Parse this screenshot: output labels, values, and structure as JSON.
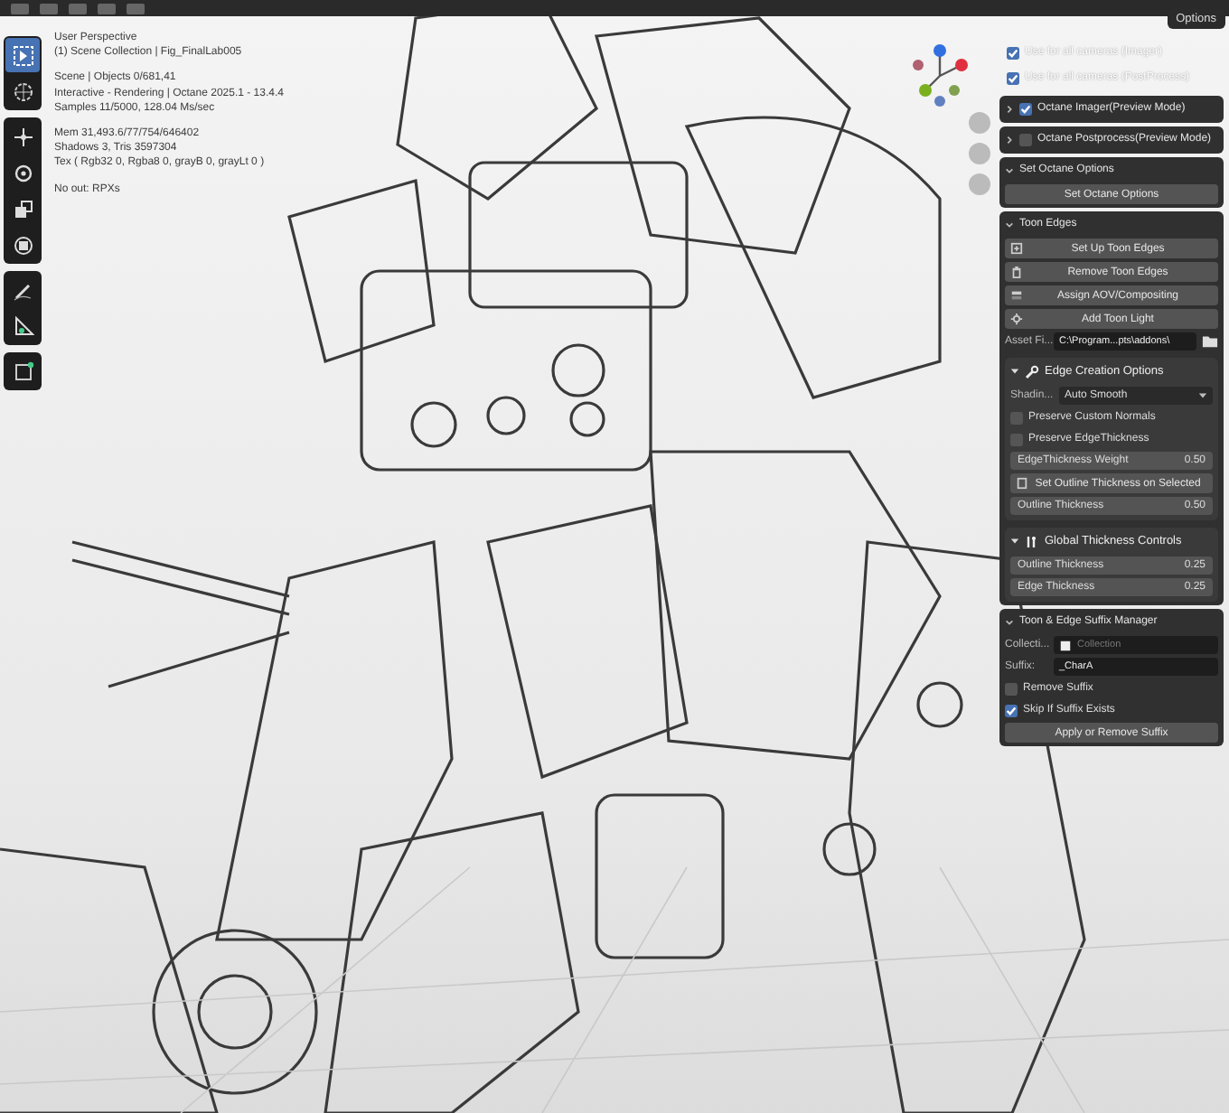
{
  "viewport_info": [
    [
      "User Perspective",
      "(1) Scene Collection | Fig_FinalLab005"
    ],
    [
      "Scene | Objects 0/681,41",
      "Interactive - Rendering | Octane 2025.1 - 13.4.4",
      "Samples 11/5000, 128.04 Ms/sec"
    ],
    [
      "Mem 31,493.6/77/754/646402",
      "Shadows 3, Tris 3597304",
      "Tex ( Rgb32 0, Rgba8 0, grayB 0, grayLt 0 )"
    ],
    [
      "No out: RPXs"
    ]
  ],
  "tools": [
    {
      "kind": "select",
      "selected": true
    },
    {
      "kind": "cursor",
      "selected": false
    },
    {
      "kind": "move",
      "selected": false
    },
    {
      "kind": "rotate",
      "selected": false
    },
    {
      "kind": "scale",
      "selected": false
    },
    {
      "kind": "transform",
      "selected": false
    },
    {
      "kind": "annotate",
      "selected": false
    },
    {
      "kind": "measure",
      "selected": false
    },
    {
      "kind": "add",
      "selected": false
    }
  ],
  "options_button": "Options",
  "camera_toggles": [
    {
      "label": "Use for all cameras (Imager)",
      "checked": true
    },
    {
      "label": "Use for all cameras (PostProcess)",
      "checked": true
    }
  ],
  "panels": [
    {
      "title": "Octane Imager(Preview Mode)",
      "checked": true,
      "expanded": false
    },
    {
      "title": "Octane Postprocess(Preview Mode)",
      "checked": false,
      "expanded": false
    },
    {
      "title": "Set Octane Options",
      "expanded": true,
      "items": [
        {
          "kind": "button",
          "label": "Set Octane Options"
        }
      ]
    },
    {
      "title": "Toon Edges",
      "expanded": true,
      "items": [
        {
          "kind": "button",
          "label": "Set Up Toon Edges"
        },
        {
          "kind": "button",
          "label": "Remove Toon Edges"
        },
        {
          "kind": "button",
          "label": "Assign AOV/Compositing"
        },
        {
          "kind": "button",
          "label": "Add Toon Light"
        },
        {
          "kind": "path",
          "label": "Asset Fi...",
          "value": "C:\\Program...pts\\addons\\"
        },
        {
          "kind": "subpanel",
          "title": "Edge Creation Options",
          "expanded": true,
          "items": [
            {
              "kind": "dropdown",
              "label": "Shadin...",
              "value": "Auto Smooth"
            },
            {
              "kind": "checkbox",
              "label": "Preserve Custom Normals",
              "checked": false
            },
            {
              "kind": "checkbox",
              "label": "Preserve EdgeThickness",
              "checked": false
            },
            {
              "kind": "number",
              "label": "EdgeThickness Weight",
              "value": "0.50"
            },
            {
              "kind": "button",
              "label": "Set Outline Thickness on Selected"
            },
            {
              "kind": "number",
              "label": "Outline Thickness",
              "value": "0.50"
            }
          ]
        },
        {
          "kind": "subpanel",
          "title": "Global Thickness Controls",
          "expanded": true,
          "items": [
            {
              "kind": "number",
              "label": "Outline Thickness",
              "value": "0.25"
            },
            {
              "kind": "number",
              "label": "Edge Thickness",
              "value": "0.25"
            }
          ]
        }
      ]
    },
    {
      "title": "Toon & Edge Suffix Manager",
      "expanded": true,
      "items": [
        {
          "kind": "collection",
          "label": "Collecti...",
          "placeholder": "Collection"
        },
        {
          "kind": "text",
          "label": "Suffix:",
          "value": "_CharA"
        },
        {
          "kind": "checkbox",
          "label": "Remove Suffix",
          "checked": false
        },
        {
          "kind": "checkbox",
          "label": "Skip If Suffix Exists",
          "checked": true
        },
        {
          "kind": "button",
          "label": "Apply or Remove Suffix"
        }
      ]
    }
  ]
}
